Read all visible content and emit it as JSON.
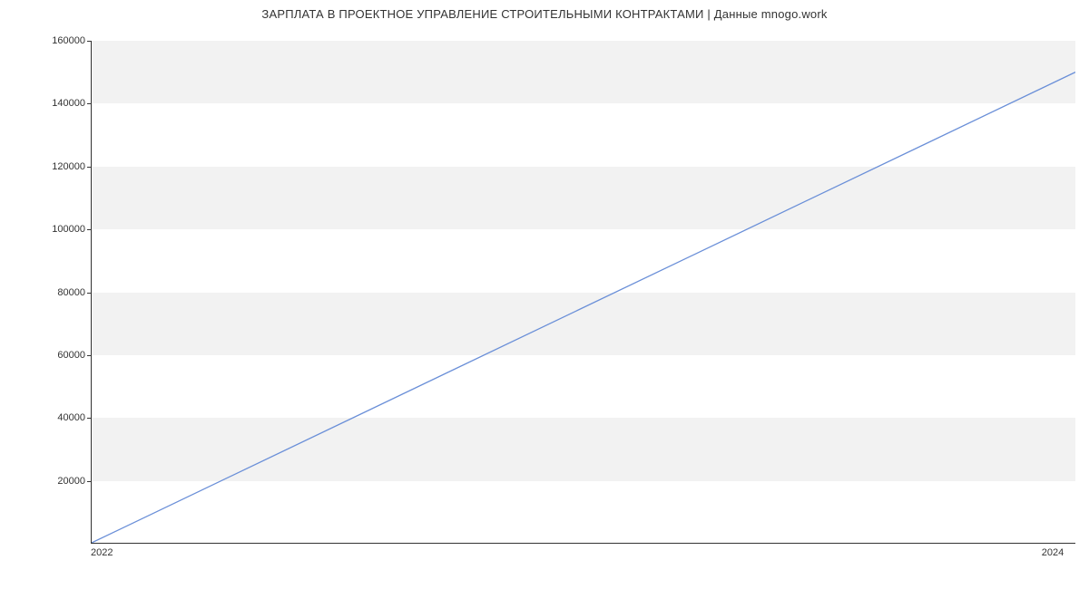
{
  "chart_data": {
    "type": "line",
    "title": "ЗАРПЛАТА В ПРОЕКТНОЕ УПРАВЛЕНИЕ СТРОИТЕЛЬНЫМИ КОНТРАКТАМИ | Данные mnogo.work",
    "x": [
      2022,
      2024
    ],
    "values": [
      0,
      150000
    ],
    "xlabel": "",
    "ylabel": "",
    "xlim": [
      2022,
      2024
    ],
    "ylim": [
      0,
      160000
    ],
    "y_ticks": [
      20000,
      40000,
      60000,
      80000,
      100000,
      120000,
      140000,
      160000
    ],
    "x_ticks": [
      2022,
      2024
    ],
    "line_color": "#6a8fd8"
  }
}
